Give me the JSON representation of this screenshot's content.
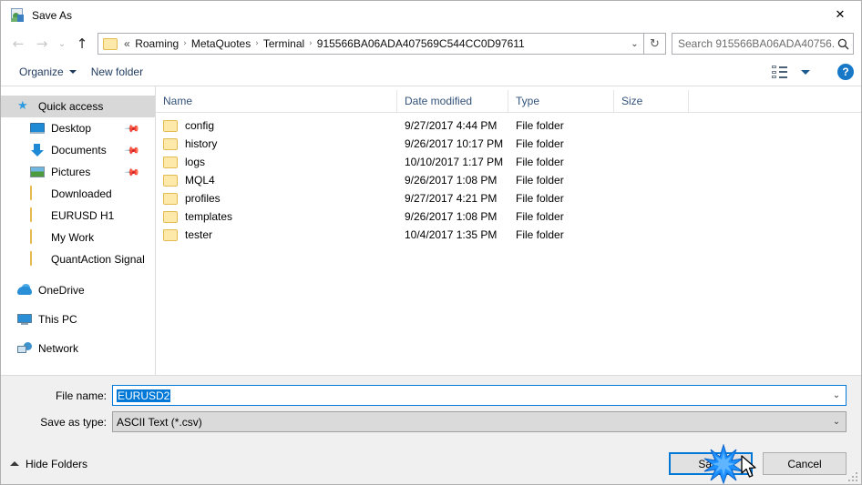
{
  "window": {
    "title": "Save As",
    "icon": "save-as-icon",
    "close_label": "✕"
  },
  "nav": {
    "back_icon": "arrow-left-icon",
    "forward_icon": "arrow-right-icon",
    "recent_icon": "chevron-down-icon",
    "up_icon": "arrow-up-icon",
    "back_glyph": "←",
    "forward_glyph": "→",
    "recent_glyph": "⌄",
    "up_glyph": "↑",
    "refresh_glyph": "↻",
    "dropdown_glyph": "⌄"
  },
  "address": {
    "lead": "«",
    "separator": "›",
    "crumbs": [
      "Roaming",
      "MetaQuotes",
      "Terminal",
      "915566BA06ADA407569C544CC0D97611"
    ]
  },
  "search": {
    "placeholder": "Search 915566BA06ADA40756...",
    "icon_glyph": "🔍"
  },
  "toolbar": {
    "organize_label": "Organize",
    "new_folder_label": "New folder",
    "view_icon": "view-mode-icon",
    "help_label": "?"
  },
  "sidebar": {
    "items": [
      {
        "label": "Quick access",
        "icon": "star-icon",
        "selected": true,
        "indent": false,
        "pinned": false
      },
      {
        "label": "Desktop",
        "icon": "desktop-icon",
        "selected": false,
        "indent": true,
        "pinned": true
      },
      {
        "label": "Documents",
        "icon": "documents-icon",
        "selected": false,
        "indent": true,
        "pinned": true
      },
      {
        "label": "Pictures",
        "icon": "pictures-icon",
        "selected": false,
        "indent": true,
        "pinned": true
      },
      {
        "label": "Downloaded",
        "icon": "folder-icon",
        "selected": false,
        "indent": true,
        "pinned": false
      },
      {
        "label": "EURUSD H1",
        "icon": "folder-icon",
        "selected": false,
        "indent": true,
        "pinned": false
      },
      {
        "label": "My Work",
        "icon": "folder-icon",
        "selected": false,
        "indent": true,
        "pinned": false
      },
      {
        "label": "QuantAction Signal",
        "icon": "folder-icon",
        "selected": false,
        "indent": true,
        "pinned": false
      },
      {
        "label": "OneDrive",
        "icon": "onedrive-icon",
        "selected": false,
        "indent": false,
        "pinned": false
      },
      {
        "label": "This PC",
        "icon": "this-pc-icon",
        "selected": false,
        "indent": false,
        "pinned": false
      },
      {
        "label": "Network",
        "icon": "network-icon",
        "selected": false,
        "indent": false,
        "pinned": false
      }
    ],
    "pin_glyph": "📌"
  },
  "filelist": {
    "columns": [
      "Name",
      "Date modified",
      "Type",
      "Size"
    ],
    "sort_column": "Name",
    "sort_direction": "ascending",
    "rows": [
      {
        "name": "config",
        "date": "9/27/2017 4:44 PM",
        "type": "File folder",
        "size": ""
      },
      {
        "name": "history",
        "date": "9/26/2017 10:17 PM",
        "type": "File folder",
        "size": ""
      },
      {
        "name": "logs",
        "date": "10/10/2017 1:17 PM",
        "type": "File folder",
        "size": ""
      },
      {
        "name": "MQL4",
        "date": "9/26/2017 1:08 PM",
        "type": "File folder",
        "size": ""
      },
      {
        "name": "profiles",
        "date": "9/27/2017 4:21 PM",
        "type": "File folder",
        "size": ""
      },
      {
        "name": "templates",
        "date": "9/26/2017 1:08 PM",
        "type": "File folder",
        "size": ""
      },
      {
        "name": "tester",
        "date": "10/4/2017 1:35 PM",
        "type": "File folder",
        "size": ""
      }
    ]
  },
  "fields": {
    "file_name_label": "File name:",
    "file_name_value": "EURUSD2",
    "file_name_selected": true,
    "save_as_type_label": "Save as type:",
    "save_as_type_value": "ASCII Text (*.csv)"
  },
  "footer": {
    "hide_folders_label": "Hide Folders",
    "save_label": "Save",
    "cancel_label": "Cancel"
  },
  "colors": {
    "accent": "#0078d7",
    "selection": "#0078d7",
    "sidebar_selected": "#d8d8d8",
    "folder": "#fde9a9",
    "header_text": "#33537a",
    "panel": "#f0f0f0"
  }
}
